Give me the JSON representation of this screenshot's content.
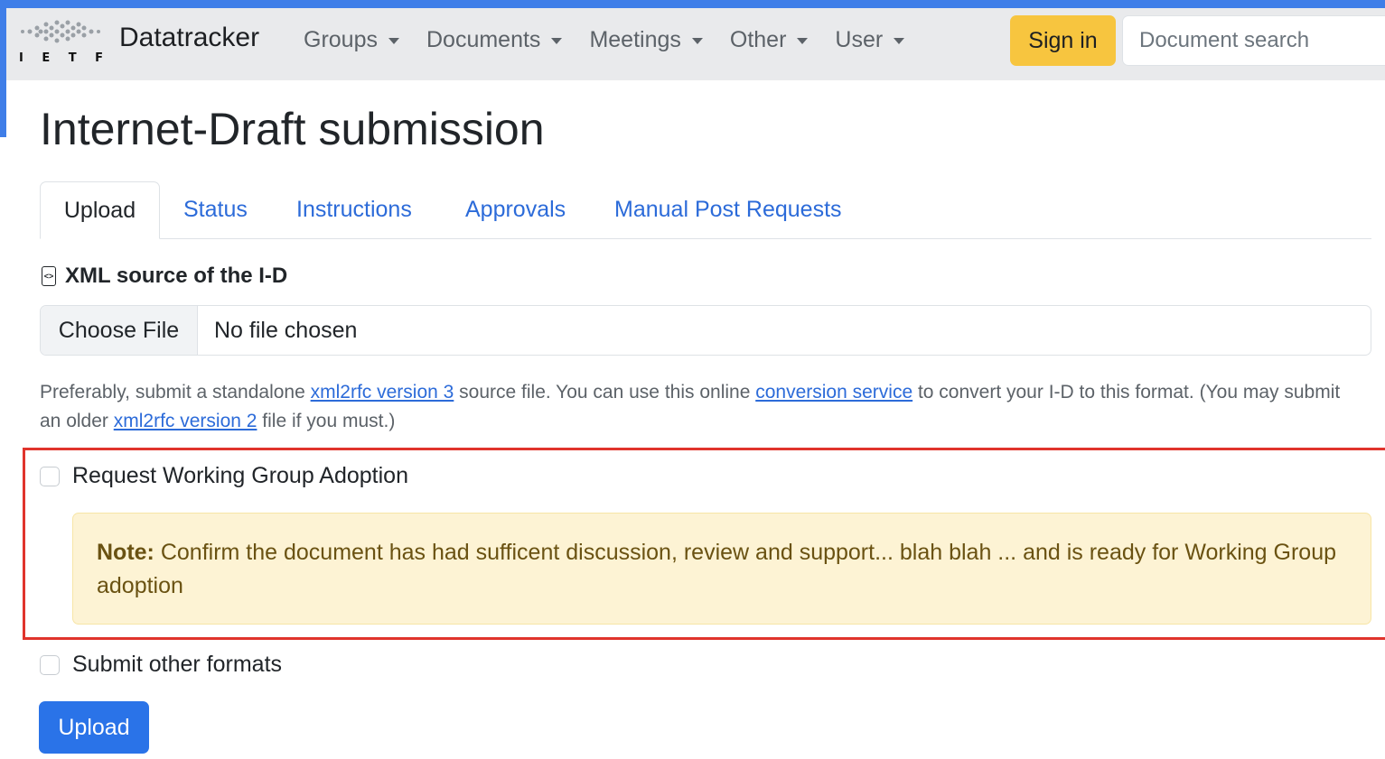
{
  "brand": {
    "logo_letters": [
      "I",
      "E",
      "T",
      "F"
    ],
    "name": "Datatracker"
  },
  "nav": {
    "items": [
      {
        "label": "Groups"
      },
      {
        "label": "Documents"
      },
      {
        "label": "Meetings"
      },
      {
        "label": "Other"
      },
      {
        "label": "User"
      }
    ],
    "signin_label": "Sign in",
    "search_placeholder": "Document search"
  },
  "page": {
    "title": "Internet-Draft submission"
  },
  "tabs": [
    {
      "label": "Upload",
      "active": true
    },
    {
      "label": "Status"
    },
    {
      "label": "Instructions"
    },
    {
      "label": "Approvals"
    },
    {
      "label": "Manual Post Requests"
    }
  ],
  "form": {
    "xml_label": "XML source of the I-D",
    "choose_file_label": "Choose File",
    "no_file_text": "No file chosen",
    "help": {
      "p1": "Preferably, submit a standalone ",
      "link1": "xml2rfc version 3",
      "p2": " source file. You can use this online ",
      "link2": "conversion service",
      "p3": " to convert your I-D to this format. (You may submit an older ",
      "link3": "xml2rfc version 2",
      "p4": " file if you must.)"
    },
    "wg_adoption_label": "Request Working Group Adoption",
    "note_prefix": "Note:",
    "note_text": " Confirm the document has had sufficent discussion, review and support... blah blah ... and is ready for Working Group adoption",
    "other_formats_label": "Submit other formats",
    "upload_label": "Upload"
  },
  "colors": {
    "accent_blue": "#2a73e8",
    "signin_yellow": "#f7c53f",
    "highlight_red": "#e0342c",
    "note_bg": "#fdf3d4"
  }
}
